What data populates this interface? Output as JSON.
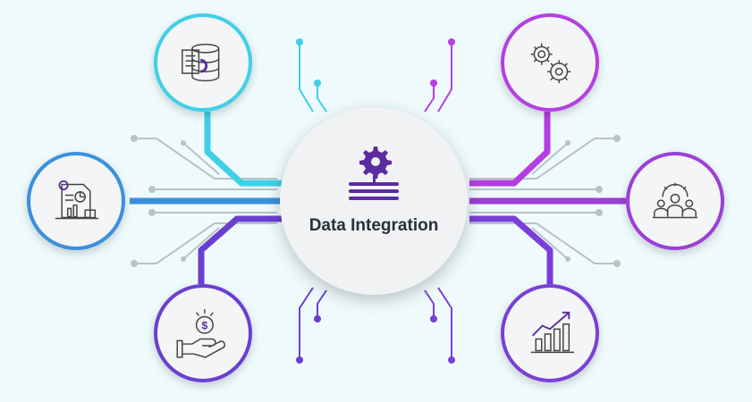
{
  "hub": {
    "title": "Data Integration",
    "icon": "gear-server-icon"
  },
  "nodes": [
    {
      "id": "database-node",
      "icon": "database-document-icon"
    },
    {
      "id": "report-node",
      "icon": "report-chart-icon"
    },
    {
      "id": "payment-node",
      "icon": "hand-dollar-coin-icon"
    },
    {
      "id": "settings-node",
      "icon": "gears-icon"
    },
    {
      "id": "team-node",
      "icon": "team-gear-icon"
    },
    {
      "id": "growth-node",
      "icon": "growth-chart-icon"
    }
  ],
  "colors": {
    "background": "#eefafc",
    "cyan": "#3fd0e6",
    "blue": "#3a8fe0",
    "violet": "#6a3fd0",
    "magenta": "#b43fe0",
    "purple": "#7a3fd8",
    "icon_purple": "#5b2ca0",
    "grey_line": "#b9c2c7"
  }
}
